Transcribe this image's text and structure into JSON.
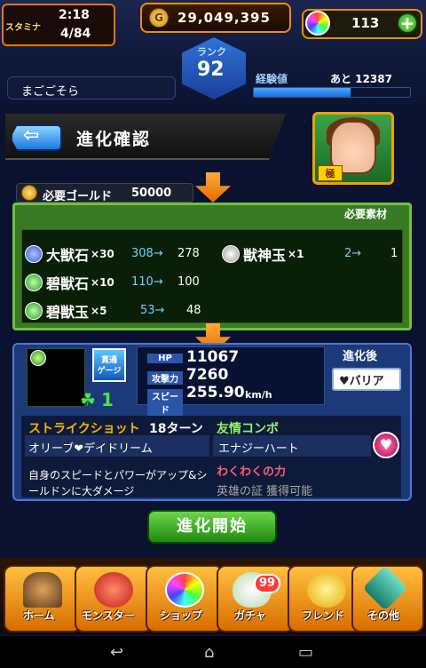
{
  "hud": {
    "stamina_label": "スタミナ",
    "stamina_timer": "2:18",
    "stamina_count": "4/84",
    "gold": "29,049,395",
    "orbs": "113",
    "orb_add": "+",
    "player_name": "まごごそら",
    "rank_label": "ランク",
    "rank": "92",
    "exp_label": "経験値",
    "exp_remaining": "あと 12387",
    "exp_fraction": 0.62
  },
  "header": {
    "back_arrow": "⇦",
    "title": "進化確認",
    "portrait_tag": "極"
  },
  "gold_requirement": {
    "label": "必要ゴールド",
    "value": "50000"
  },
  "materials": {
    "header": "必要素材",
    "items": [
      {
        "name": "大獣石",
        "qty": "×30",
        "have": "308→",
        "after": "278",
        "color": "#5a8cff"
      },
      {
        "name": "獣神玉",
        "qty": "×1",
        "have": "2→",
        "after": "1",
        "color": "#e0e0e0"
      },
      {
        "name": "碧獣石",
        "qty": "×10",
        "have": "110→",
        "after": "100",
        "color": "#47c04a"
      },
      {
        "name": "碧獣玉",
        "qty": "×5",
        "have": "53→",
        "after": "48",
        "color": "#47c04a"
      }
    ]
  },
  "card": {
    "pierce": "貫通\nゲージ",
    "luck_icon": "☘",
    "luck": "1",
    "hp_label": "HP",
    "hp": "11067",
    "atk_label": "攻撃力",
    "atk": "7260",
    "spd_label": "スピード",
    "spd": "255.90",
    "spd_unit": "km/h",
    "evo_after": "進化後",
    "ability": "♥バリア",
    "ss_label": "ストライクショット",
    "ss_turns": "18ターン",
    "combo_label": "友情コンボ",
    "ss_name": "オリーブ❤デイドリーム",
    "combo_name": "エナジーハート",
    "heart_icon": "♥",
    "ss_desc": "自身のスピードとパワーがアップ&シールドンに大ダメージ",
    "sub_label": "わくわくの力",
    "sub_text": "英雄の証 獲得可能"
  },
  "start_button": "進化開始",
  "nav": [
    {
      "label": "ホーム",
      "color": "#6b4a2a"
    },
    {
      "label": "モンスター",
      "color": "#e84040"
    },
    {
      "label": "ショップ",
      "color": "#8e6bff"
    },
    {
      "label": "ガチャ",
      "color": "#d8f0d0"
    },
    {
      "label": "フレンド",
      "color": "#ffd84a"
    },
    {
      "label": "その他",
      "color": "#3fae9a"
    }
  ],
  "gacha_badge": "99",
  "system_bar": {
    "back": "↩",
    "home": "⌂",
    "recents": "▭"
  }
}
